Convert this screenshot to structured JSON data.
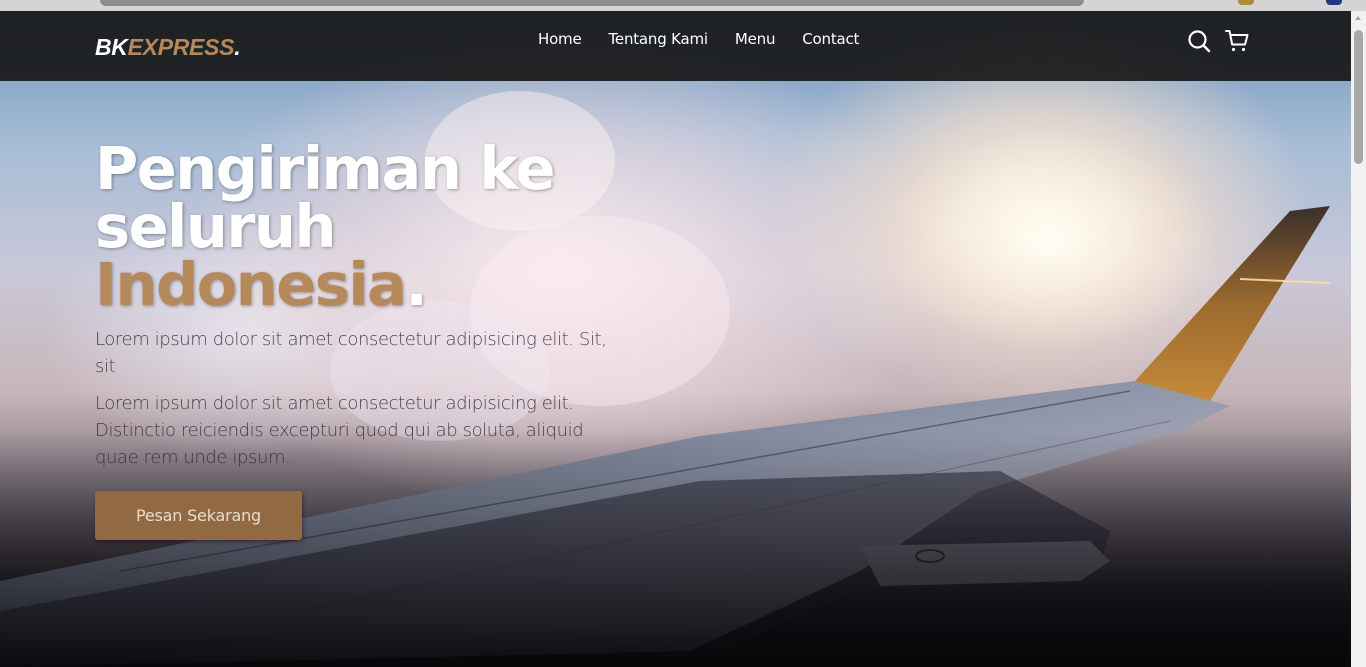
{
  "brand": {
    "logo_prefix": "BK",
    "logo_accent": "EXPRESS",
    "logo_suffix": ".",
    "accent_color": "#b6895b"
  },
  "nav": {
    "links": [
      {
        "label": "Home"
      },
      {
        "label": "Tentang Kami"
      },
      {
        "label": "Menu"
      },
      {
        "label": "Contact"
      }
    ],
    "icons": [
      "search-icon",
      "shopping-cart-icon"
    ]
  },
  "hero": {
    "title_line1": "Pengiriman ke",
    "title_line2": "seluruh",
    "title_highlight": "Indonesia",
    "title_end": ".",
    "paragraph1": "Lorem ipsum dolor sit amet consectetur adipisicing elit. Sit, sit",
    "paragraph2": "Lorem ipsum dolor sit amet consectetur adipisicing elit. Distinctio reiciendis excepturi quod qui ab soluta, aliquid quae rem unde ipsum.",
    "cta_label": "Pesan Sekarang",
    "cta_color": "#916a43"
  }
}
